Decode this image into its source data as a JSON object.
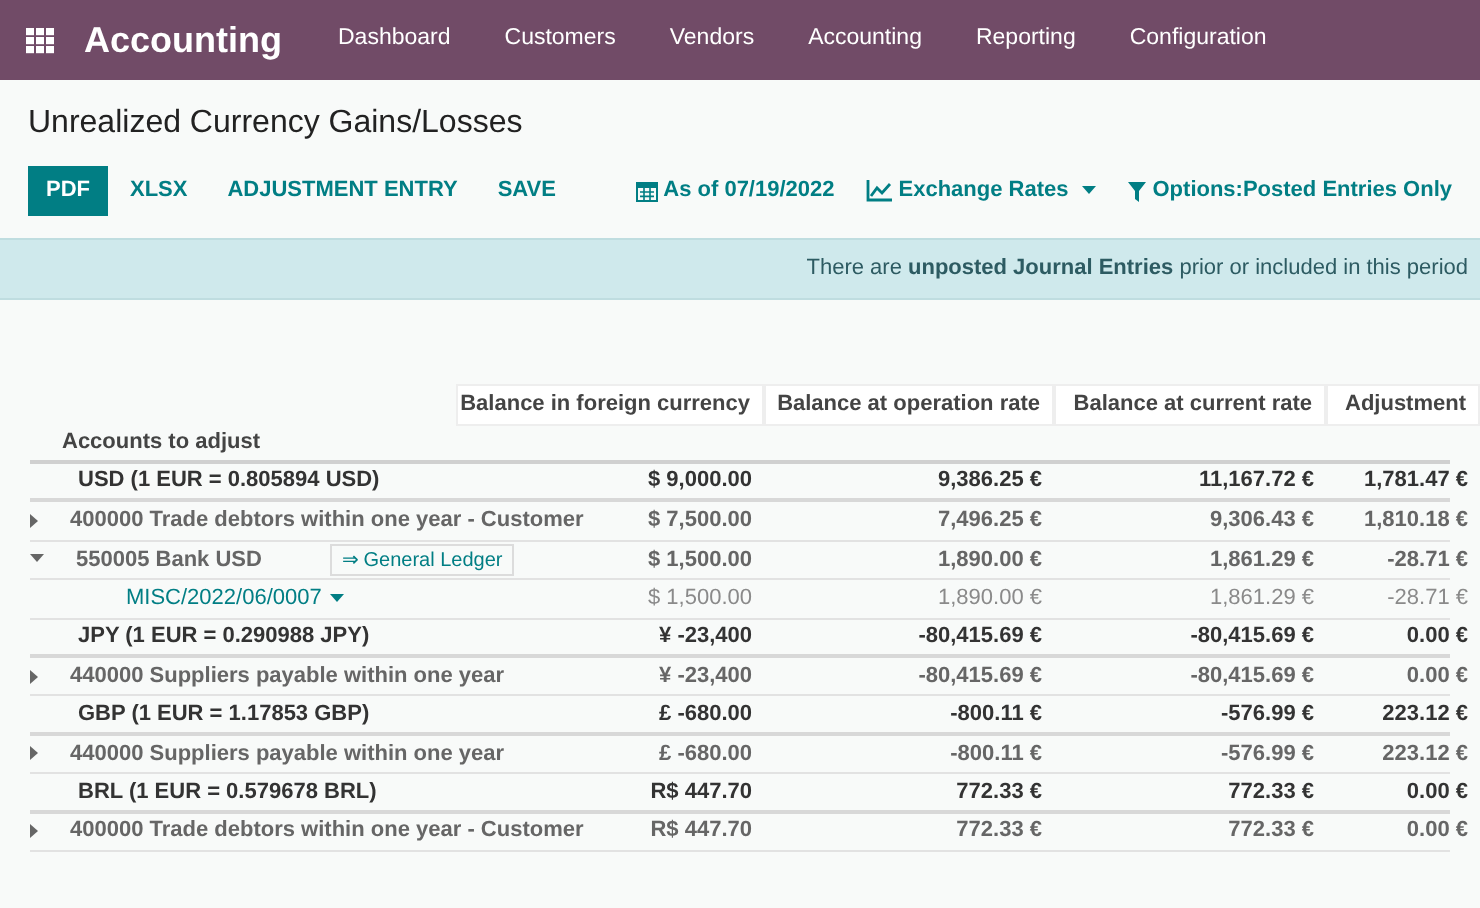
{
  "app": {
    "name": "Accounting"
  },
  "menu": [
    "Dashboard",
    "Customers",
    "Vendors",
    "Accounting",
    "Reporting",
    "Configuration"
  ],
  "title": "Unrealized Currency Gains/Losses",
  "buttons": [
    {
      "label": "PDF",
      "primary": true
    },
    {
      "label": "XLSX",
      "primary": false
    },
    {
      "label": "ADJUSTMENT ENTRY",
      "primary": false
    },
    {
      "label": "SAVE",
      "primary": false
    }
  ],
  "filters": [
    {
      "kind": "date",
      "label": "As of 07/19/2022",
      "dropdown": false
    },
    {
      "kind": "chart",
      "label": "Exchange Rates",
      "dropdown": true
    },
    {
      "kind": "filter",
      "label": "Options:Posted Entries Only",
      "dropdown": false
    }
  ],
  "banner": "There are **unposted Journal Entries** prior or included in this period",
  "table": {
    "columns": [
      "Balance in foreign currency",
      "Balance at operation rate",
      "Balance at current rate",
      "Adjustment"
    ],
    "row_header": "Accounts to adjust",
    "rows": [
      {
        "kind": "currency",
        "label": "USD (1 EUR = 0.805894 USD)",
        "cells": [
          "$ 9,000.00",
          "9,386.25 €",
          "11,167.72 €",
          "1,781.47 €"
        ]
      },
      {
        "kind": "account",
        "expanded": false,
        "label": "400000 Trade debtors within one year - Customer",
        "cells": [
          "$ 7,500.00",
          "7,496.25 €",
          "9,306.43 €",
          "1,810.18 €"
        ]
      },
      {
        "kind": "account",
        "expanded": true,
        "label": "550005 Bank USD",
        "link": "⇒ General Ledger",
        "cells": [
          "$ 1,500.00",
          "1,890.00 €",
          "1,861.29 €",
          "-28.71 €"
        ]
      },
      {
        "kind": "entry",
        "label": "MISC/2022/06/0007",
        "dropdown": true,
        "cells": [
          "$ 1,500.00",
          "1,890.00 €",
          "1,861.29 €",
          "-28.71 €"
        ]
      },
      {
        "kind": "currency",
        "label": "JPY (1 EUR = 0.290988 JPY)",
        "cells": [
          "¥ -23,400",
          "-80,415.69 €",
          "-80,415.69 €",
          "0.00 €"
        ]
      },
      {
        "kind": "account",
        "expanded": false,
        "label": "440000 Suppliers payable within one year",
        "cells": [
          "¥ -23,400",
          "-80,415.69 €",
          "-80,415.69 €",
          "0.00 €"
        ]
      },
      {
        "kind": "currency",
        "label": "GBP (1 EUR = 1.17853 GBP)",
        "cells": [
          "£ -680.00",
          "-800.11 €",
          "-576.99 €",
          "223.12 €"
        ]
      },
      {
        "kind": "account",
        "expanded": false,
        "label": "440000 Suppliers payable within one year",
        "cells": [
          "£ -680.00",
          "-800.11 €",
          "-576.99 €",
          "223.12 €"
        ]
      },
      {
        "kind": "currency",
        "label": "BRL (1 EUR = 0.579678 BRL)",
        "cells": [
          "R$ 447.70",
          "772.33 €",
          "772.33 €",
          "0.00 €"
        ]
      },
      {
        "kind": "account",
        "expanded": false,
        "label": "400000 Trade debtors within one year - Customer",
        "cells": [
          "R$ 447.70",
          "772.33 €",
          "772.33 €",
          "0.00 €"
        ]
      }
    ]
  }
}
